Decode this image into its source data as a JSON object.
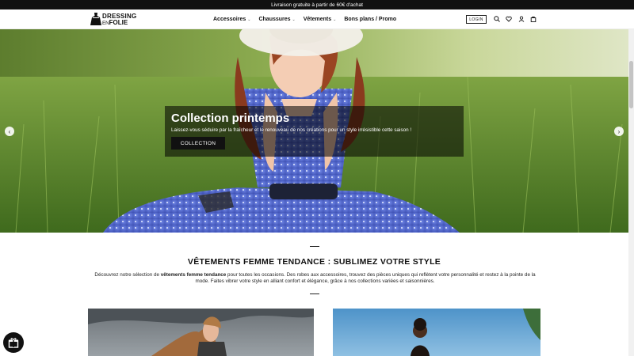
{
  "announcement": "Livraison gratuite à partir de 60€ d'achat",
  "brand": {
    "line1": "DRESSING",
    "line2_en": "EN",
    "line2": "FOLIE"
  },
  "nav": [
    {
      "label": "Accessoires",
      "has_dropdown": true
    },
    {
      "label": "Chaussures",
      "has_dropdown": true
    },
    {
      "label": "Vêtements",
      "has_dropdown": true
    },
    {
      "label": "Bons plans / Promo",
      "has_dropdown": false
    }
  ],
  "header": {
    "login_label": "LOGIN",
    "icons": [
      "search-icon",
      "heart-icon",
      "user-icon",
      "cart-icon"
    ]
  },
  "hero": {
    "title": "Collection printemps",
    "subtitle": "Laissez-vous séduire par la fraîcheur et le renouveau de nos créations pour un style irrésistible cette saison !",
    "button": "COLLECTION",
    "prev": "‹",
    "next": "›"
  },
  "section": {
    "heading": "VÊTEMENTS FEMME TENDANCE : SUBLIMEZ VOTRE STYLE",
    "desc_start": "Découvrez notre sélection de ",
    "desc_bold": "vêtements femme tendance",
    "desc_end": " pour toutes les occasions. Des robes aux accessoires, trouvez des pièces uniques qui reflètent votre personnalité et restez à la pointe de la mode. Faites vibrer votre style en alliant confort et élégance, grâce à nos collections variées et saisonnières."
  },
  "colors": {
    "topbar": "#111111",
    "accent": "#111111",
    "overlay": "rgba(0,0,0,0.55)"
  },
  "widget": {
    "icon": "gift-icon"
  }
}
